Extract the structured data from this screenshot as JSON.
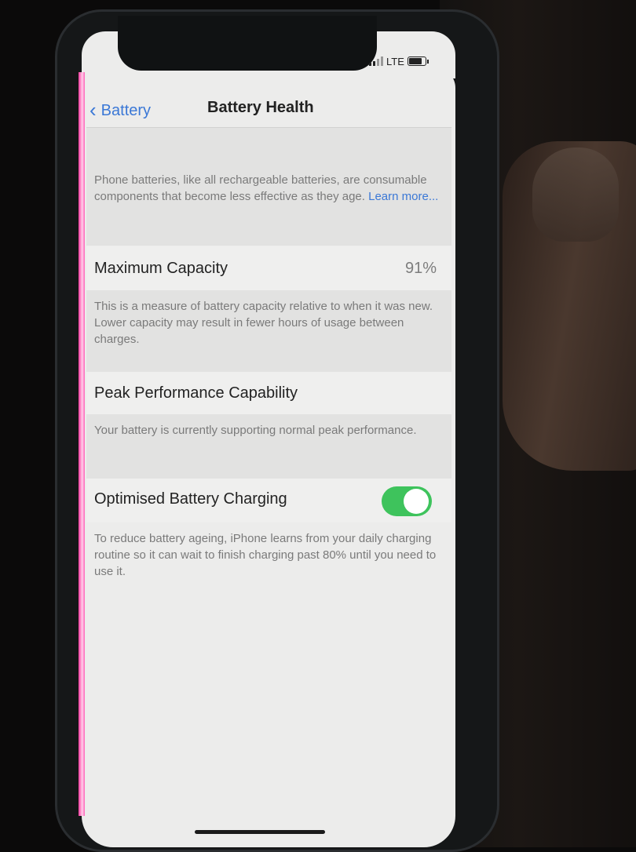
{
  "status_bar": {
    "network": "LTE",
    "signal_icon": "cellular-signal-icon",
    "battery_icon": "battery-icon"
  },
  "nav": {
    "back_label": "Battery",
    "back_icon": "chevron-left-icon",
    "title": "Battery Health"
  },
  "intro": {
    "text": "Phone batteries, like all rechargeable batteries, are consumable components that become less effective as they age.",
    "link": "Learn more..."
  },
  "maximum_capacity": {
    "label": "Maximum Capacity",
    "value": "91%",
    "description": "This is a measure of battery capacity relative to when it was new. Lower capacity may result in fewer hours of usage between charges."
  },
  "peak_performance": {
    "label": "Peak Performance Capability",
    "description": "Your battery is currently supporting normal peak performance."
  },
  "optimised_charging": {
    "label": "Optimised Battery Charging",
    "enabled": true,
    "toggle_color": "#3ec35c",
    "description": "To reduce battery ageing, iPhone learns from your daily charging routine so it can wait to finish charging past 80% until you need to use it."
  }
}
